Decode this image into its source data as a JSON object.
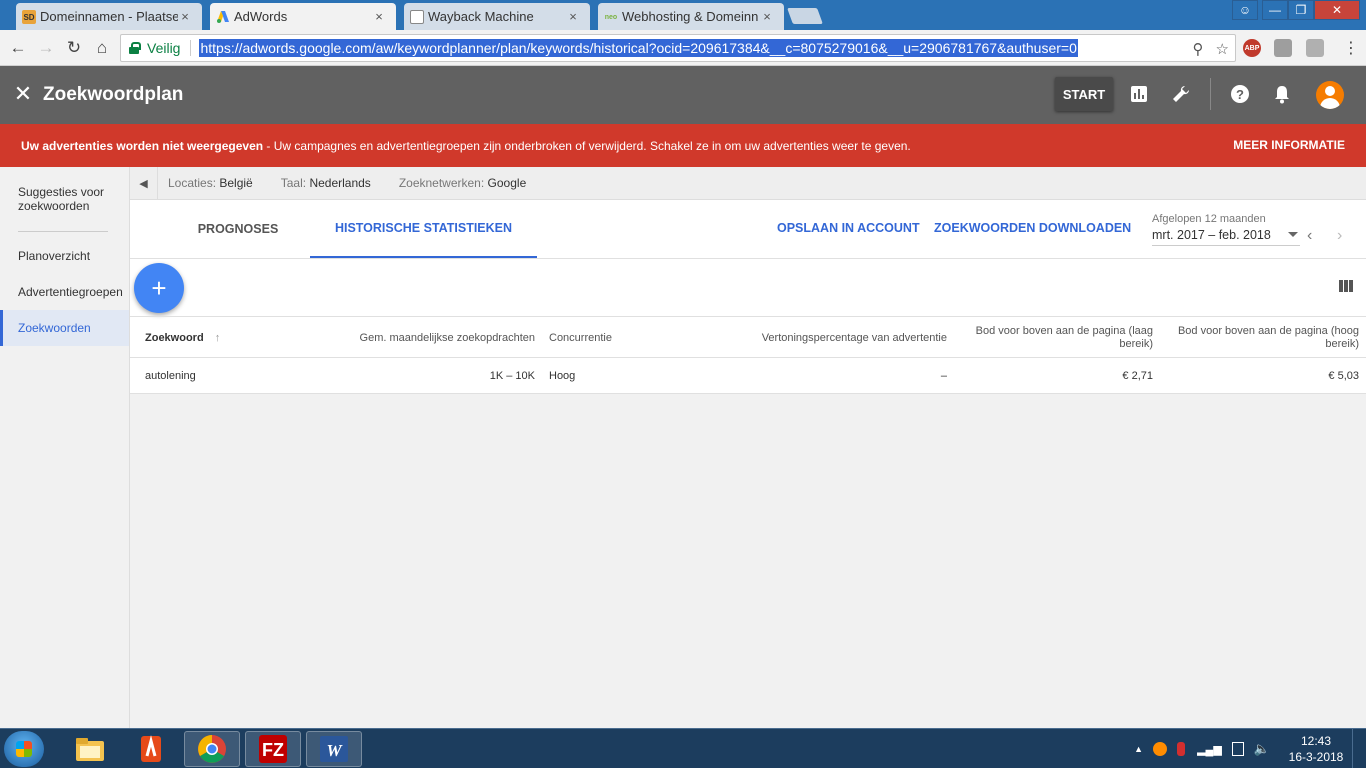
{
  "browser": {
    "tabs": [
      {
        "title": "Domeinnamen - Plaatser",
        "icon": "sd-favicon",
        "active": false
      },
      {
        "title": "AdWords",
        "icon": "adwords-favicon",
        "active": true
      },
      {
        "title": "Wayback Machine",
        "icon": "document-icon",
        "active": false
      },
      {
        "title": "Webhosting & Domeinn",
        "icon": "neo-favicon",
        "active": false
      }
    ],
    "close_glyph": "×",
    "secure_label": "Veilig",
    "url": "https://adwords.google.com/aw/keywordplanner/plan/keywords/historical?ocid=209617384&__c=8075279016&__u=2906781767&authuser=0",
    "ext_abp": "ABP"
  },
  "app": {
    "title": "Zoekwoordplan",
    "start_label": "START"
  },
  "alert": {
    "bold": "Uw advertenties worden niet weergegeven",
    "text": " - Uw campagnes en advertentiegroepen zijn onderbroken of verwijderd. Schakel ze in om uw advertenties weer te geven.",
    "link": "MEER INFORMATIE",
    "color": "#d0392b"
  },
  "sidebar": {
    "items": [
      {
        "label": "Suggesties voor zoekwoorden",
        "active": false
      },
      {
        "label": "Planoverzicht",
        "active": false
      },
      {
        "label": "Advertentiegroepen",
        "active": false
      },
      {
        "label": "Zoekwoorden",
        "active": true
      }
    ]
  },
  "filters": {
    "locations_label": "Locaties:",
    "locations_value": "België",
    "language_label": "Taal:",
    "language_value": "Nederlands",
    "networks_label": "Zoeknetwerken:",
    "networks_value": "Google"
  },
  "tabs": {
    "prognoses": "PROGNOSES",
    "historical": "HISTORISCHE STATISTIEKEN"
  },
  "actions": {
    "save": "OPSLAAN IN ACCOUNT",
    "download": "ZOEKWOORDEN DOWNLOADEN"
  },
  "daterange": {
    "label": "Afgelopen 12 maanden",
    "value": "mrt. 2017 – feb. 2018"
  },
  "table": {
    "headers": {
      "keyword": "Zoekwoord",
      "searches": "Gem. maandelijkse zoekopdrachten",
      "competition": "Concurrentie",
      "impression_share": "Vertoningspercentage van advertentie",
      "bid_low": "Bod voor boven aan de pagina (laag bereik)",
      "bid_high": "Bod voor boven aan de pagina (hoog bereik)"
    },
    "rows": [
      {
        "keyword": "autolening",
        "searches": "1K – 10K",
        "competition": "Hoog",
        "impression_share": "–",
        "bid_low": "€ 2,71",
        "bid_high": "€ 5,03"
      }
    ]
  },
  "taskbar": {
    "time": "12:43",
    "date": "16-3-2018"
  },
  "colors": {
    "accent": "#3367d6",
    "header": "#616161",
    "fab": "#4285f4"
  }
}
